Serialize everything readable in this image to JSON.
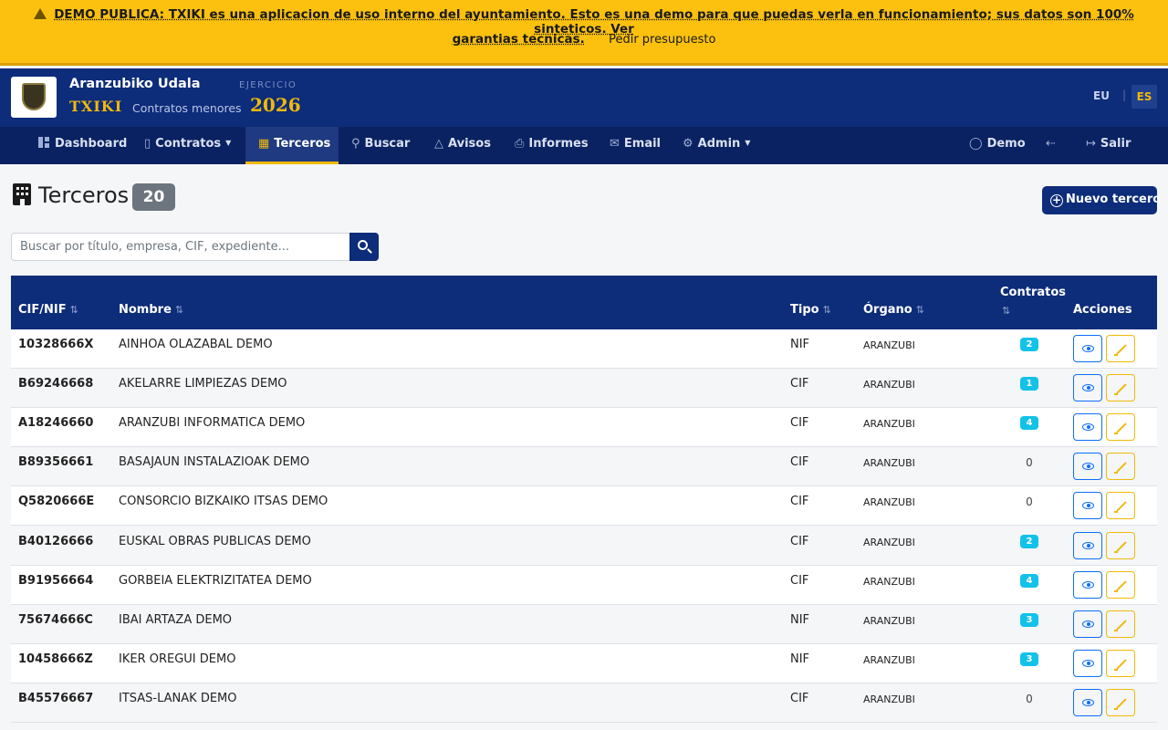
{
  "banner": {
    "line1": "DEMO PUBLICA: TXIKI es una aplicacion de uso interno del ayuntamiento. Esto es una demo para que puedas verla en funcionamiento; sus datos son 100% sinteticos. Ver",
    "line2_link": "garantias tecnicas.",
    "cta": "Pedir presupuesto"
  },
  "header": {
    "org_name": "Aranzubiko Udala",
    "brand": "TXIKI",
    "subtitle": "Contratos menores",
    "ejercicio_label": "EJERCICIO",
    "year": "2026",
    "lang_eu": "EU",
    "lang_sep": "|",
    "lang_es": "ES"
  },
  "nav": {
    "dashboard": "Dashboard",
    "contratos": "Contratos",
    "terceros": "Terceros",
    "buscar": "Buscar",
    "avisos": "Avisos",
    "informes": "Informes",
    "email": "Email",
    "admin": "Admin",
    "user": "Demo",
    "salir": "Salir"
  },
  "page": {
    "title": "Terceros",
    "count": "20",
    "new_button": "Nuevo tercero",
    "search_placeholder": "Buscar por título, empresa, CIF, expediente..."
  },
  "table": {
    "headers": {
      "cif": "CIF/NIF",
      "nombre": "Nombre",
      "tipo": "Tipo",
      "organo": "Órgano",
      "contratos": "Contratos",
      "acciones": "Acciones"
    },
    "rows": [
      {
        "cif": "10328666X",
        "nombre": "AINHOA OLAZABAL DEMO",
        "tipo": "NIF",
        "organo": "ARANZUBI",
        "contratos": "2"
      },
      {
        "cif": "B69246668",
        "nombre": "AKELARRE LIMPIEZAS DEMO",
        "tipo": "CIF",
        "organo": "ARANZUBI",
        "contratos": "1"
      },
      {
        "cif": "A18246660",
        "nombre": "ARANZUBI INFORMATICA DEMO",
        "tipo": "CIF",
        "organo": "ARANZUBI",
        "contratos": "4"
      },
      {
        "cif": "B89356661",
        "nombre": "BASAJAUN INSTALAZIOAK DEMO",
        "tipo": "CIF",
        "organo": "ARANZUBI",
        "contratos": "0"
      },
      {
        "cif": "Q5820666E",
        "nombre": "CONSORCIO BIZKAIKO ITSAS DEMO",
        "tipo": "CIF",
        "organo": "ARANZUBI",
        "contratos": "0"
      },
      {
        "cif": "B40126666",
        "nombre": "EUSKAL OBRAS PUBLICAS DEMO",
        "tipo": "CIF",
        "organo": "ARANZUBI",
        "contratos": "2"
      },
      {
        "cif": "B91956664",
        "nombre": "GORBEIA ELEKTRIZITATEA DEMO",
        "tipo": "CIF",
        "organo": "ARANZUBI",
        "contratos": "4"
      },
      {
        "cif": "75674666C",
        "nombre": "IBAI ARTAZA DEMO",
        "tipo": "NIF",
        "organo": "ARANZUBI",
        "contratos": "3"
      },
      {
        "cif": "10458666Z",
        "nombre": "IKER OREGUI DEMO",
        "tipo": "NIF",
        "organo": "ARANZUBI",
        "contratos": "3"
      },
      {
        "cif": "B45576667",
        "nombre": "ITSAS-LANAK DEMO",
        "tipo": "CIF",
        "organo": "ARANZUBI",
        "contratos": "0"
      }
    ]
  },
  "colors": {
    "banner": "#fcc10e",
    "header": "#0d2c7a",
    "nav": "#0a2261",
    "accent": "#f0b90b",
    "badge": "#12c2e9"
  }
}
